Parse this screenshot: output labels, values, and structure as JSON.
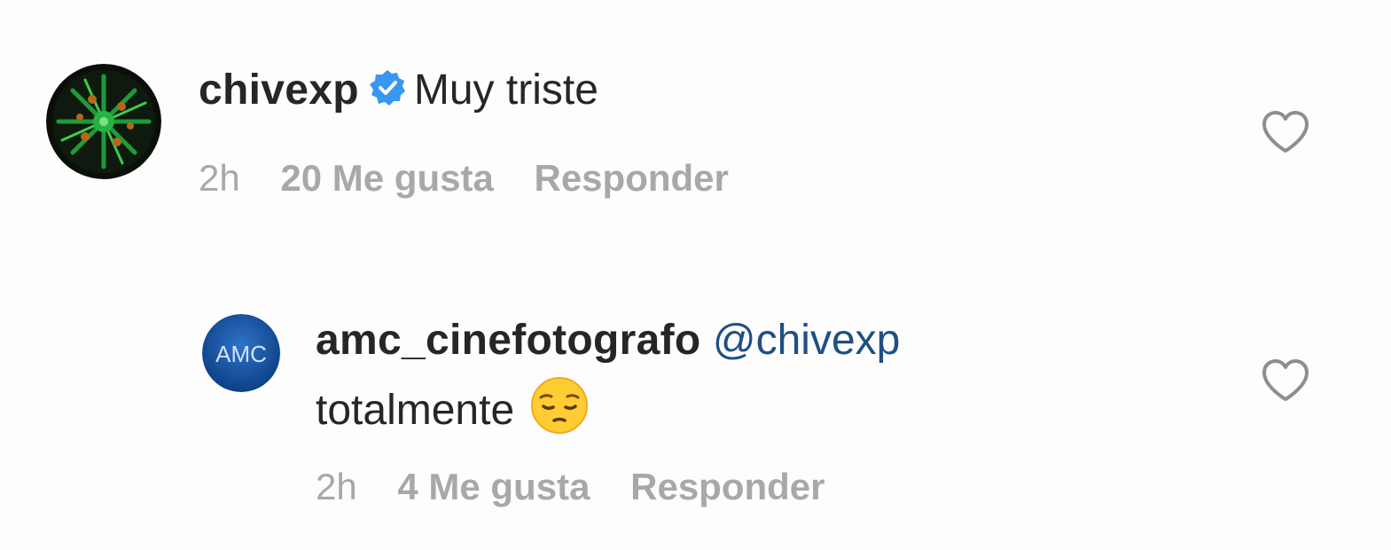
{
  "comments": [
    {
      "username": "chivexp",
      "verified_icon": "verified-badge-icon",
      "text": "Muy triste",
      "time": "2h",
      "likes": "20 Me gusta",
      "reply": "Responder",
      "avatar_icon": "green-starburst-avatar"
    },
    {
      "username": "amc_cinefotografo",
      "mention": "@chivexp",
      "text": "totalmente",
      "emoji_icon": "pensive-face-icon",
      "time": "2h",
      "likes": "4 Me gusta",
      "reply": "Responder",
      "avatar_text": "AMC"
    }
  ],
  "colors": {
    "mention": "#1f4f82",
    "meta": "#a8a8a8",
    "verified": "#3897f0",
    "text": "#262626"
  }
}
